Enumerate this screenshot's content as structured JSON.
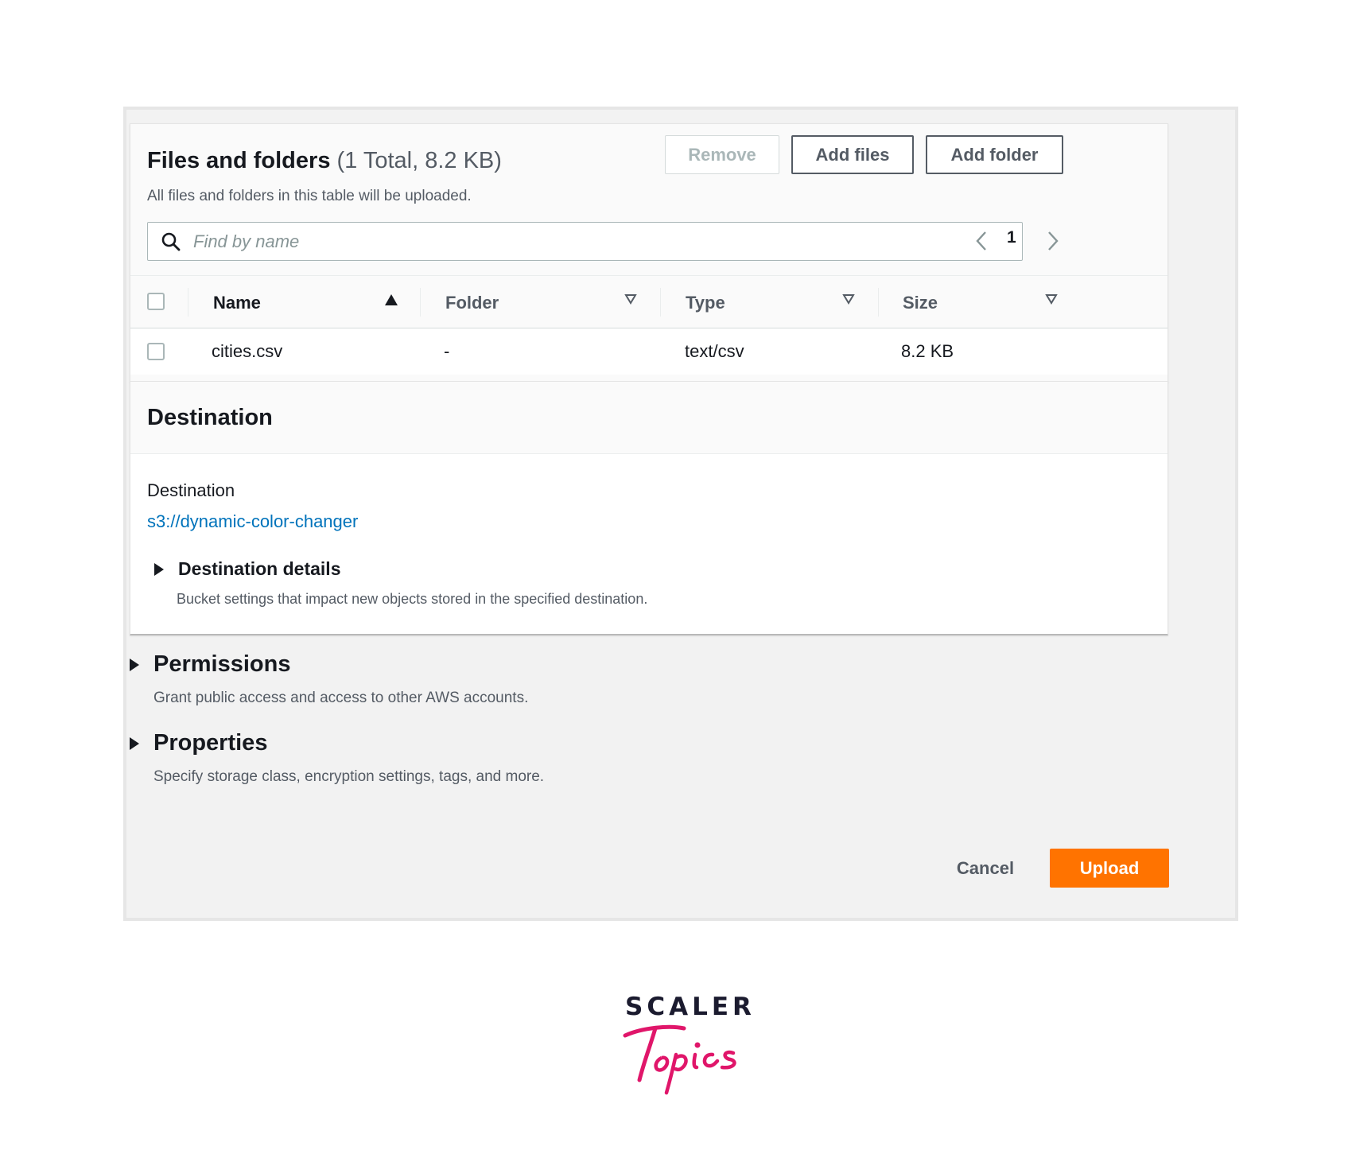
{
  "files": {
    "title": "Files and folders",
    "count": "(1 Total, 8.2 KB)",
    "subtitle": "All files and folders in this table will be uploaded.",
    "remove_label": "Remove",
    "add_files_label": "Add files",
    "add_folder_label": "Add folder",
    "search_placeholder": "Find by name",
    "page": "1",
    "columns": [
      "Name",
      "Folder",
      "Type",
      "Size"
    ],
    "rows": [
      {
        "name": "cities.csv",
        "folder": "-",
        "type": "text/csv",
        "size": "8.2 KB"
      }
    ]
  },
  "destination": {
    "title": "Destination",
    "label": "Destination",
    "link": "s3://dynamic-color-changer",
    "details_title": "Destination details",
    "details_desc": "Bucket settings that impact new objects stored in the specified destination."
  },
  "permissions": {
    "title": "Permissions",
    "desc": "Grant public access and access to other AWS accounts."
  },
  "properties": {
    "title": "Properties",
    "desc": "Specify storage class, encryption settings, tags, and more."
  },
  "actions": {
    "cancel_label": "Cancel",
    "upload_label": "Upload"
  },
  "logo": {
    "word": "SCALER",
    "script": "Topics"
  },
  "colors": {
    "accent": "#ff7300",
    "link": "#0073bb",
    "logo_pink": "#e0166a"
  }
}
